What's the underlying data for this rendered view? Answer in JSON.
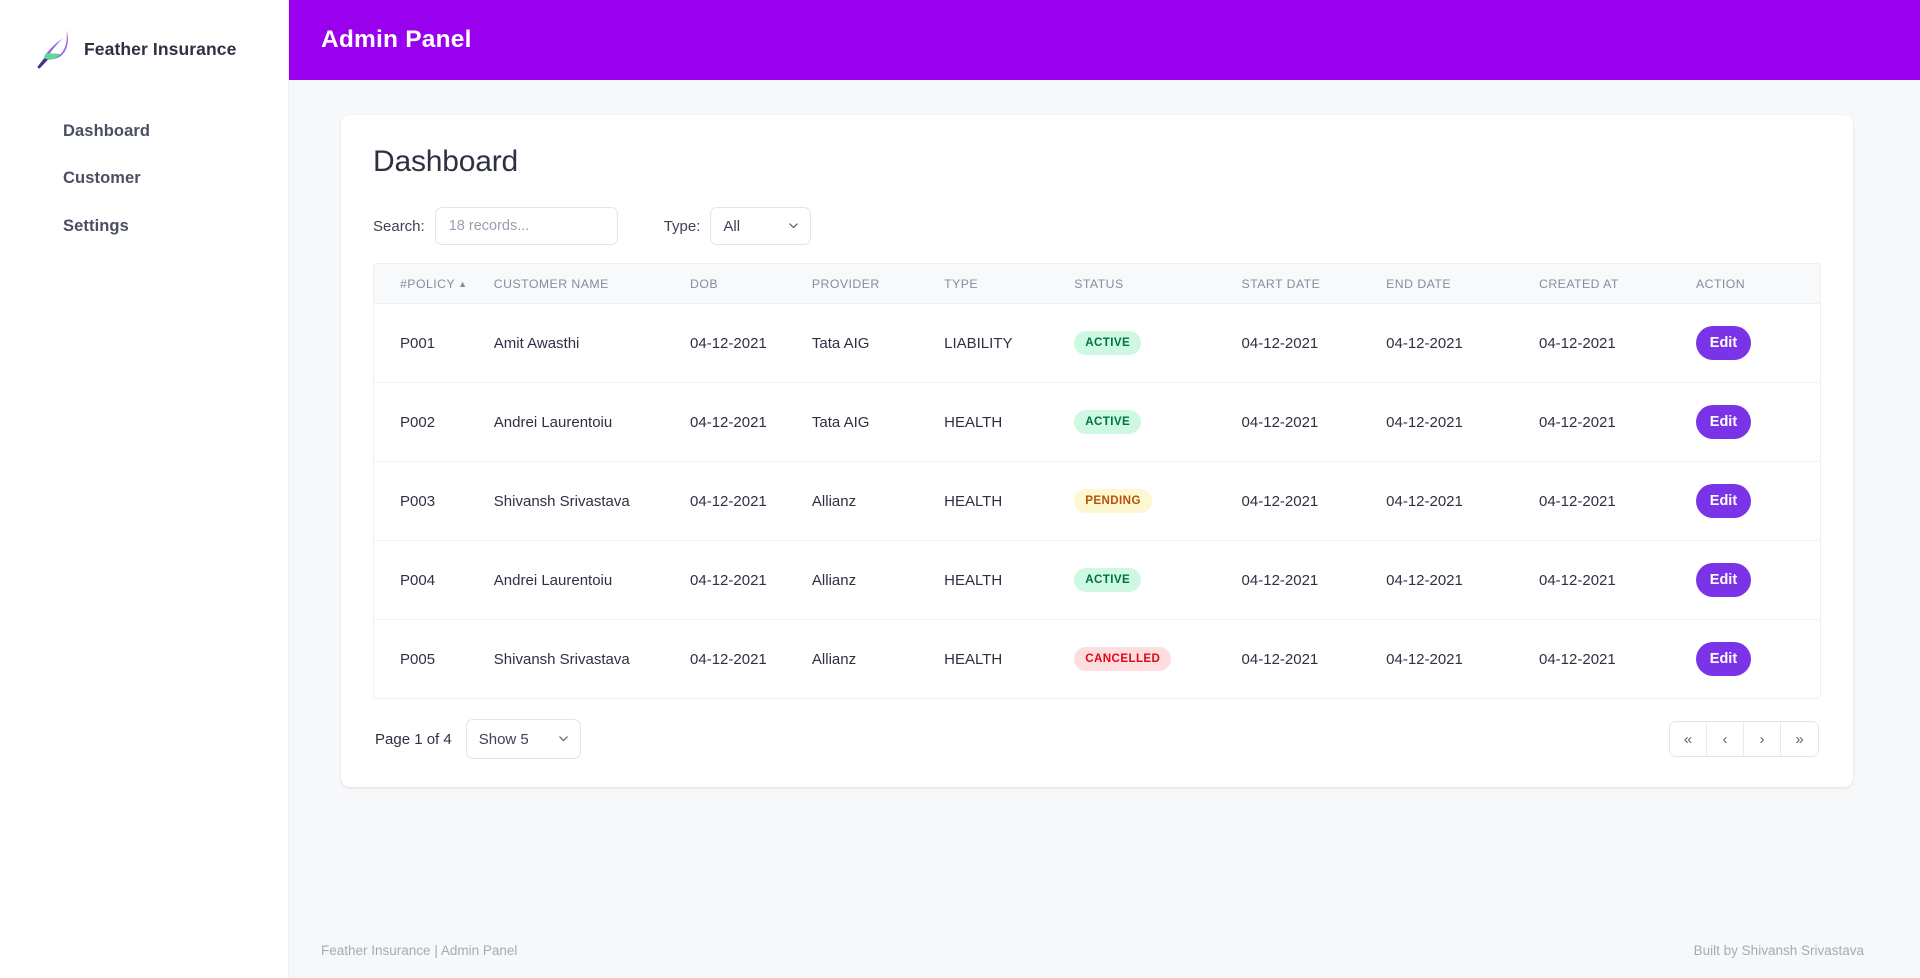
{
  "brand": {
    "name": "Feather Insurance",
    "logo_icon": "feather-icon"
  },
  "sidebar": {
    "items": [
      {
        "label": "Dashboard"
      },
      {
        "label": "Customer"
      },
      {
        "label": "Settings"
      }
    ]
  },
  "topbar": {
    "title": "Admin Panel",
    "background_color": "#9900ee"
  },
  "page": {
    "title": "Dashboard"
  },
  "filters": {
    "search_label": "Search:",
    "search_value": "",
    "search_placeholder": "18 records...",
    "type_label": "Type:",
    "type_value": "All",
    "type_options": [
      "All"
    ],
    "chevron_icon": "chevron-down-icon"
  },
  "table": {
    "columns": [
      {
        "key": "policy",
        "label": "#POLICY",
        "sorted": true,
        "sort_caret": "▲"
      },
      {
        "key": "name",
        "label": "CUSTOMER NAME",
        "sorted": false
      },
      {
        "key": "dob",
        "label": "DOB",
        "sorted": false
      },
      {
        "key": "provider",
        "label": "PROVIDER",
        "sorted": false
      },
      {
        "key": "type",
        "label": "TYPE",
        "sorted": false
      },
      {
        "key": "status",
        "label": "STATUS",
        "sorted": false
      },
      {
        "key": "start",
        "label": "START DATE",
        "sorted": false
      },
      {
        "key": "end",
        "label": "END DATE",
        "sorted": false
      },
      {
        "key": "created",
        "label": "CREATED AT",
        "sorted": false
      },
      {
        "key": "action",
        "label": "ACTION",
        "sorted": false
      }
    ],
    "rows": [
      {
        "policy": "P001",
        "name": "Amit Awasthi",
        "dob": "04-12-2021",
        "provider": "Tata AIG",
        "type": "LIABILITY",
        "status": "ACTIVE",
        "status_kind": "active",
        "start": "04-12-2021",
        "end": "04-12-2021",
        "created": "04-12-2021",
        "action": "Edit"
      },
      {
        "policy": "P002",
        "name": "Andrei Laurentoiu",
        "dob": "04-12-2021",
        "provider": "Tata AIG",
        "type": "HEALTH",
        "status": "ACTIVE",
        "status_kind": "active",
        "start": "04-12-2021",
        "end": "04-12-2021",
        "created": "04-12-2021",
        "action": "Edit"
      },
      {
        "policy": "P003",
        "name": "Shivansh Srivastava",
        "dob": "04-12-2021",
        "provider": "Allianz",
        "type": "HEALTH",
        "status": "PENDING",
        "status_kind": "pending",
        "start": "04-12-2021",
        "end": "04-12-2021",
        "created": "04-12-2021",
        "action": "Edit"
      },
      {
        "policy": "P004",
        "name": "Andrei Laurentoiu",
        "dob": "04-12-2021",
        "provider": "Allianz",
        "type": "HEALTH",
        "status": "ACTIVE",
        "status_kind": "active",
        "start": "04-12-2021",
        "end": "04-12-2021",
        "created": "04-12-2021",
        "action": "Edit"
      },
      {
        "policy": "P005",
        "name": "Shivansh Srivastava",
        "dob": "04-12-2021",
        "provider": "Allianz",
        "type": "HEALTH",
        "status": "CANCELLED",
        "status_kind": "cancelled",
        "start": "04-12-2021",
        "end": "04-12-2021",
        "created": "04-12-2021",
        "action": "Edit"
      }
    ]
  },
  "pagination": {
    "page_text": "Page 1 of 4",
    "current_page": 1,
    "total_pages": 4,
    "show_value": "Show 5",
    "show_options": [
      "Show 5"
    ],
    "buttons": [
      {
        "name": "first-page-button",
        "glyph": "«"
      },
      {
        "name": "previous-page-button",
        "glyph": "‹"
      },
      {
        "name": "next-page-button",
        "glyph": "›"
      },
      {
        "name": "last-page-button",
        "glyph": "»"
      }
    ]
  },
  "footer": {
    "left": "Feather Insurance | Admin Panel",
    "right": "Built by Shivansh Srivastava"
  },
  "colors": {
    "accent_purple": "#9900ee",
    "button_purple": "#7b33e8",
    "status_active_bg": "#cdf8e2",
    "status_active_fg": "#00704a",
    "status_pending_bg": "#fdf8cf",
    "status_pending_fg": "#b5510a",
    "status_cancelled_bg": "#fdddde",
    "status_cancelled_fg": "#e00712"
  }
}
